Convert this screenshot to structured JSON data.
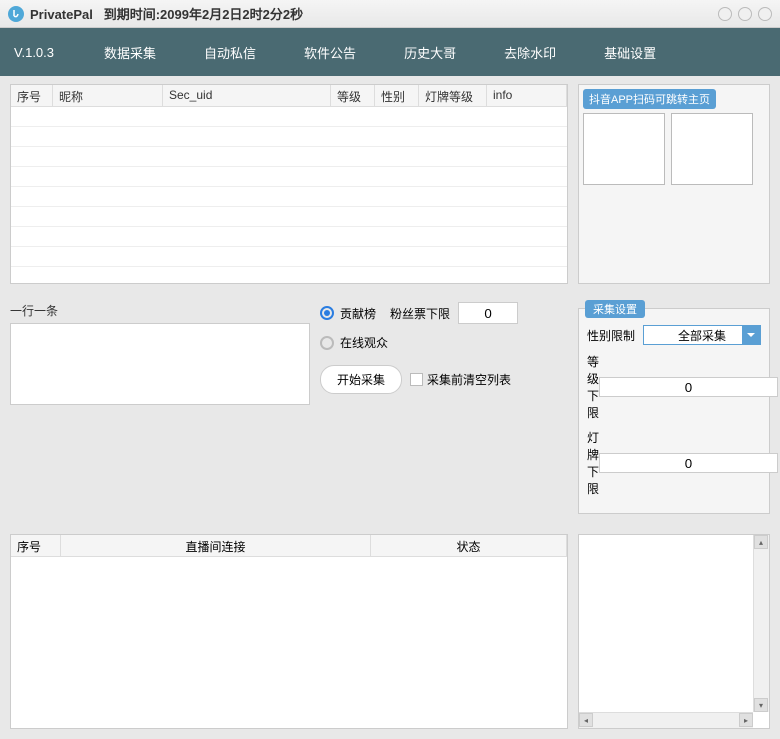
{
  "window": {
    "app_name": "PrivatePal",
    "title_suffix": "到期时间:2099年2月2日2时2分2秒"
  },
  "nav": {
    "version": "V.1.0.3",
    "items": [
      "数据采集",
      "自动私信",
      "软件公告",
      "历史大哥",
      "去除水印",
      "基础设置"
    ]
  },
  "main_table": {
    "columns": [
      "序号",
      "昵称",
      "Sec_uid",
      "等级",
      "性别",
      "灯牌等级",
      "info"
    ]
  },
  "qr": {
    "title": "抖音APP扫码可跳转主页"
  },
  "input_block": {
    "label": "一行一条"
  },
  "options": {
    "radio1": "贡献榜",
    "fans_label": "粉丝票下限",
    "fans_value": "0",
    "radio2": "在线观众",
    "start_btn": "开始采集",
    "clear_check": "采集前清空列表"
  },
  "settings": {
    "title": "采集设置",
    "gender_label": "性别限制",
    "gender_value": "全部采集",
    "level_label": "等级下限",
    "level_value": "0",
    "light_label": "灯牌下限",
    "light_value": "0"
  },
  "status_table": {
    "columns": [
      "序号",
      "直播间连接",
      "状态"
    ]
  }
}
